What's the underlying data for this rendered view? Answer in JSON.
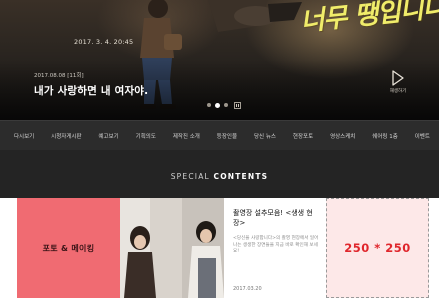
{
  "hero": {
    "date_overlay": "2017. 3. 4. 20:45",
    "script_text": "너무 땡입니다",
    "meta": "2017.08.08 [11회]",
    "title": "내가 사랑하면 내 여자야.",
    "play_label": "재생하기",
    "slides": 3,
    "active_slide": 2
  },
  "nav": {
    "items": [
      "다시보기",
      "시청자게시판",
      "예고보기",
      "기획의도",
      "제작진 소개",
      "등장인물",
      "당신 뉴스",
      "현장포토",
      "영상스케치",
      "쉐어링 1층",
      "이벤트"
    ]
  },
  "special": {
    "heading_light": "SPECIAL ",
    "heading_bold": "CONTENTS",
    "card_pink_label": "포토 & 메이킹",
    "article": {
      "title": "촬영장 설추모음! <생생 현장>",
      "desc": "<당신을 사랑합니다>의 촬영 현장에서 일어나는 생생한 장면들을 지금 바로 확인해 보세요!",
      "date": "2017.03.20"
    },
    "ad_label": "250 * 250"
  },
  "colors": {
    "accent_pink": "#f06b72",
    "ad_text": "#e0262c",
    "ad_bg": "#fde8e8",
    "script_yellow": "#f0ec6a",
    "dark_bg": "#242424"
  },
  "icons": [
    "play-triangle-icon",
    "pause-icon"
  ]
}
